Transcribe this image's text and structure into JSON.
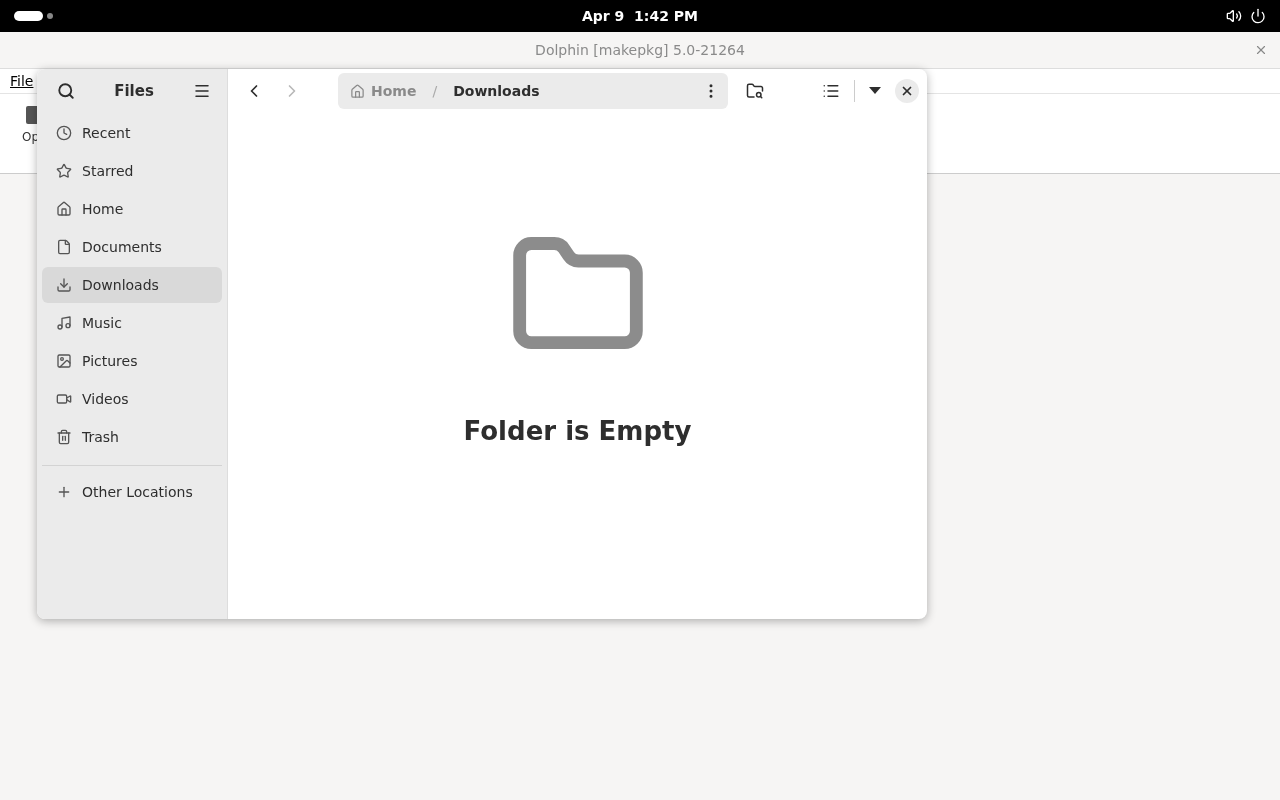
{
  "top_bar": {
    "clock": "Apr 9  1:42 PM"
  },
  "background_window": {
    "title": "Dolphin [makepkg] 5.0-21264",
    "menu": [
      "File"
    ],
    "toolbar": [
      "Op"
    ]
  },
  "files_dialog": {
    "title": "Files",
    "sidebar": {
      "items": [
        {
          "label": "Recent",
          "selected": false
        },
        {
          "label": "Starred",
          "selected": false
        },
        {
          "label": "Home",
          "selected": false
        },
        {
          "label": "Documents",
          "selected": false
        },
        {
          "label": "Downloads",
          "selected": true
        },
        {
          "label": "Music",
          "selected": false
        },
        {
          "label": "Pictures",
          "selected": false
        },
        {
          "label": "Videos",
          "selected": false
        },
        {
          "label": "Trash",
          "selected": false
        }
      ],
      "other": {
        "label": "Other Locations"
      }
    },
    "path": [
      {
        "label": "Home"
      },
      {
        "label": "Downloads"
      }
    ],
    "path_separator": "/",
    "back_disabled": false,
    "forward_disabled": true,
    "empty_message": "Folder is Empty"
  }
}
